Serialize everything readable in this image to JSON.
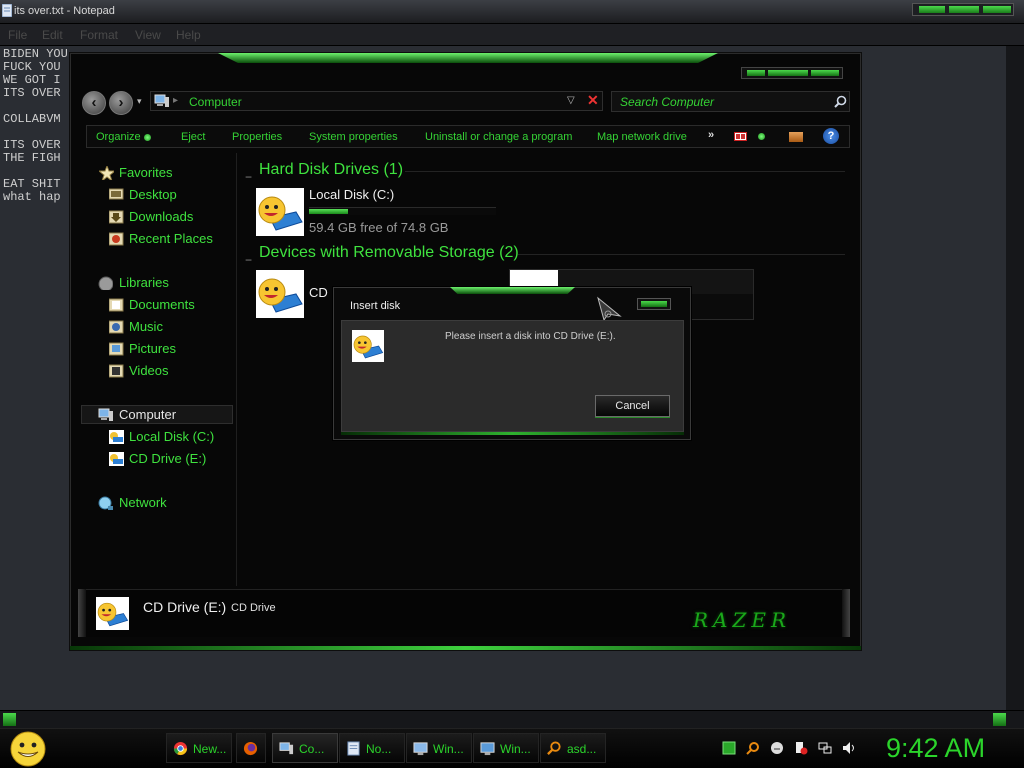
{
  "notepad": {
    "title": "its over.txt - Notepad",
    "menu": [
      "File",
      "Edit",
      "Format",
      "View",
      "Help"
    ],
    "lines": [
      "BIDEN YOU CAN QUIT",
      "FUCK YOU",
      "WE GOT I",
      "ITS OVER",
      "",
      "COLLABVM",
      "",
      "ITS OVER",
      "THE FIGH",
      "",
      "EAT SHIT",
      "what hap"
    ]
  },
  "explorer": {
    "address": "Computer",
    "search_placeholder": "Search Computer",
    "commands": [
      "Organize",
      "Eject",
      "Properties",
      "System properties",
      "Uninstall or change a program",
      "Map network drive",
      "»"
    ],
    "nav": {
      "favorites": "Favorites",
      "fav_items": [
        "Desktop",
        "Downloads",
        "Recent Places"
      ],
      "libraries": "Libraries",
      "lib_items": [
        "Documents",
        "Music",
        "Pictures",
        "Videos"
      ],
      "computer": "Computer",
      "comp_items": [
        "Local Disk (C:)",
        "CD Drive (E:)"
      ],
      "network": "Network"
    },
    "groups": {
      "hdd": "Hard Disk Drives (1)",
      "removable": "Devices with Removable Storage (2)"
    },
    "local_disk": {
      "name": "Local Disk (C:)",
      "free": "59.4 GB free of 74.8 GB",
      "used_fraction": 0.206
    },
    "cd_label": "CD",
    "details": {
      "name": "CD Drive (E:)",
      "type": "CD Drive"
    },
    "brand": "RAZER"
  },
  "dialog": {
    "title": "Insert disk",
    "message": "Please insert a disk into CD Drive (E:).",
    "cancel": "Cancel"
  },
  "taskbar": {
    "tasks": [
      "New...",
      "",
      "Co...",
      "No...",
      "Win...",
      "Win...",
      "asd..."
    ],
    "clock": "9:42 AM"
  },
  "colors": {
    "accent": "#3fe23f",
    "background": "#000000"
  }
}
